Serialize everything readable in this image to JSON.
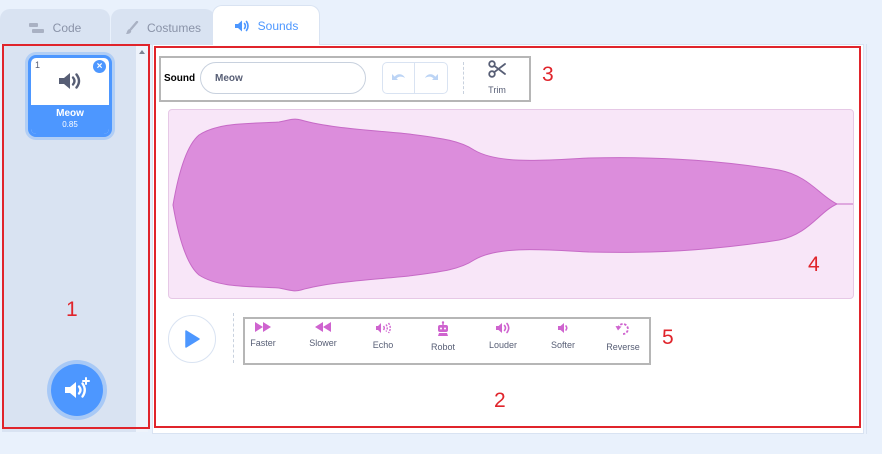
{
  "tabs": {
    "code": "Code",
    "costumes": "Costumes",
    "sounds": "Sounds"
  },
  "sound_list": {
    "items": [
      {
        "index": "1",
        "name": "Meow",
        "duration": "0.85"
      }
    ]
  },
  "editor": {
    "sound_label": "Sound",
    "sound_name": "Meow",
    "trim_label": "Trim"
  },
  "effects": [
    {
      "label": "Faster",
      "icon": "faster-icon"
    },
    {
      "label": "Slower",
      "icon": "slower-icon"
    },
    {
      "label": "Echo",
      "icon": "echo-icon"
    },
    {
      "label": "Robot",
      "icon": "robot-icon"
    },
    {
      "label": "Louder",
      "icon": "louder-icon"
    },
    {
      "label": "Softer",
      "icon": "softer-icon"
    },
    {
      "label": "Reverse",
      "icon": "reverse-icon"
    }
  ],
  "annotations": {
    "a1": "1",
    "a2": "2",
    "a3": "3",
    "a4": "4",
    "a5": "5"
  },
  "colors": {
    "accent": "#4d97ff",
    "effect": "#cf63cf",
    "waveform": "#dc8ddc",
    "annotation": "#e0242b"
  }
}
